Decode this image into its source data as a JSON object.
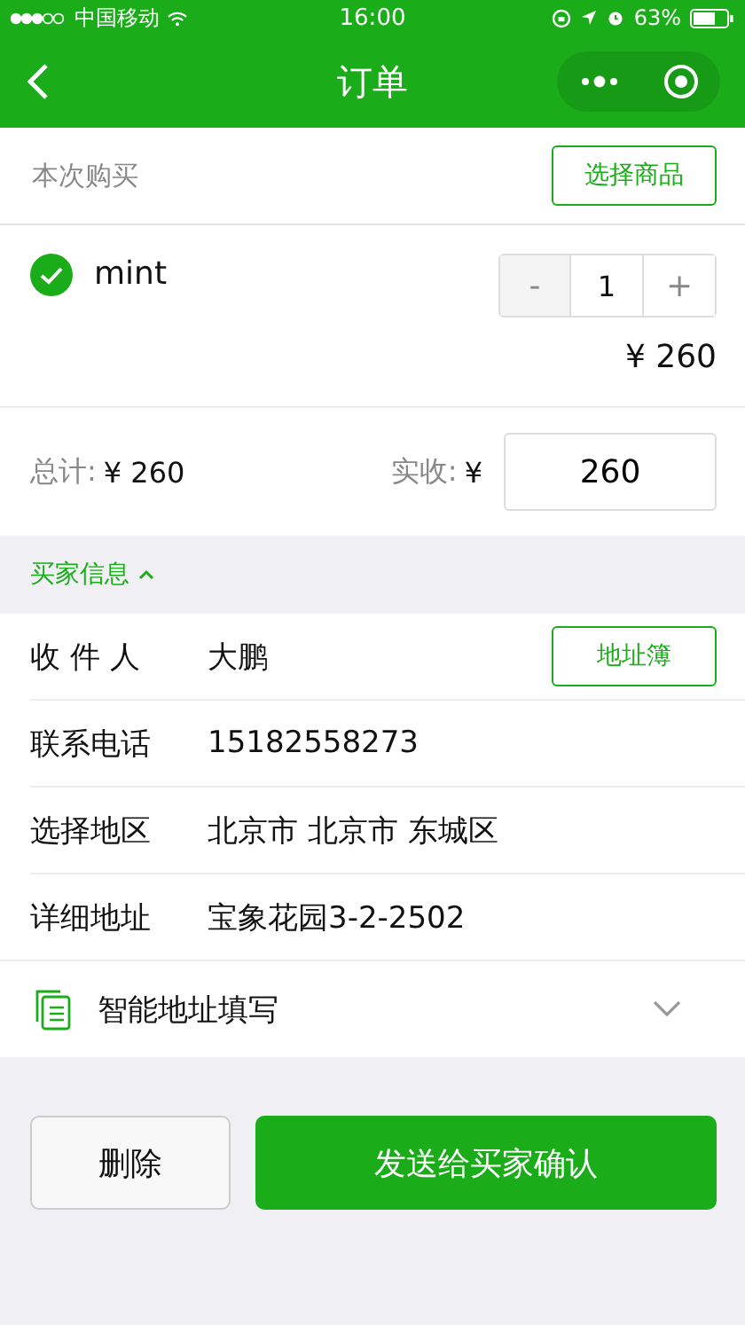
{
  "status_bar": {
    "carrier": "中国移动",
    "time": "16:00",
    "battery": "63%"
  },
  "nav": {
    "title": "订单"
  },
  "purchase": {
    "label": "本次购买",
    "button": "选择商品"
  },
  "items": [
    {
      "name": "mint",
      "checked": true,
      "minus": "-",
      "quantity": "1",
      "plus": "+",
      "price": "¥ 260"
    }
  ],
  "totals": {
    "total_label": "总计:",
    "total_value": "¥ 260",
    "received_label": "实收:",
    "currency": "¥",
    "received_value": "260"
  },
  "buyer": {
    "title": "买家信息",
    "expanded": true,
    "rows": [
      {
        "label": "收 件 人",
        "value": "大鹏",
        "button": "地址簿"
      },
      {
        "label": "联系电话",
        "value": "15182558273"
      },
      {
        "label": "选择地区",
        "value": "北京市 北京市 东城区"
      },
      {
        "label": "详细地址",
        "value": "宝象花园3-2-2502"
      }
    ]
  },
  "smart_fill": {
    "label": "智能地址填写",
    "expanded": false
  },
  "actions": [
    {
      "label": "删除",
      "kind": "secondary"
    },
    {
      "label": "发送给买家确认",
      "kind": "primary"
    }
  ]
}
